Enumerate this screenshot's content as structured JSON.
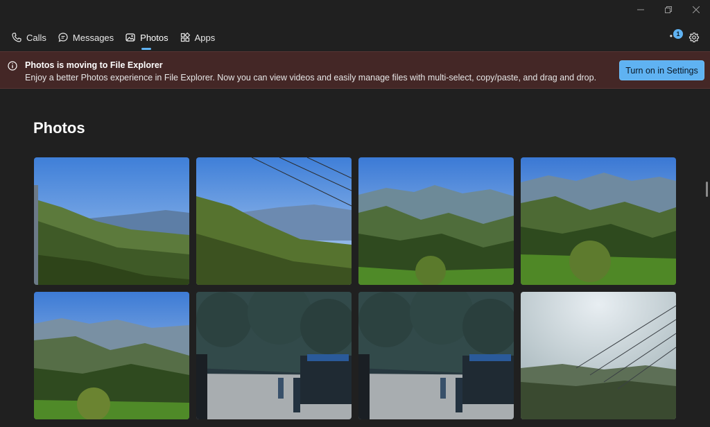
{
  "window": {
    "controls": {
      "minimize_icon": "minimize-icon",
      "restore_icon": "restore-icon",
      "close_icon": "close-icon"
    }
  },
  "tabs": [
    {
      "label": "Calls",
      "icon": "phone-icon",
      "active": false
    },
    {
      "label": "Messages",
      "icon": "chat-icon",
      "active": false
    },
    {
      "label": "Photos",
      "icon": "photos-icon",
      "active": true
    },
    {
      "label": "Apps",
      "icon": "apps-icon",
      "active": false
    }
  ],
  "notifications": {
    "badge_count": "1",
    "icon": "more-dots-icon"
  },
  "settings_icon": "gear-icon",
  "banner": {
    "icon": "info-icon",
    "title": "Photos is moving to File Explorer",
    "text": "Enjoy a better Photos experience in File Explorer. Now you can view videos and easily manage files with multi-select, copy/paste, and drag and drop.",
    "button_label": "Turn on in Settings"
  },
  "page": {
    "title": "Photos"
  },
  "photos": [
    {
      "subject": "mountain valley slope"
    },
    {
      "subject": "hillside with power lines"
    },
    {
      "subject": "green mountain ridges"
    },
    {
      "subject": "terraced hills with tree"
    },
    {
      "subject": "misty mountain valley"
    },
    {
      "subject": "roadside stall under trees"
    },
    {
      "subject": "roadside stall under trees"
    },
    {
      "subject": "hazy sky with wires"
    }
  ],
  "colors": {
    "background": "#202020",
    "accent": "#5fb2f2",
    "banner_bg": "#442726"
  }
}
